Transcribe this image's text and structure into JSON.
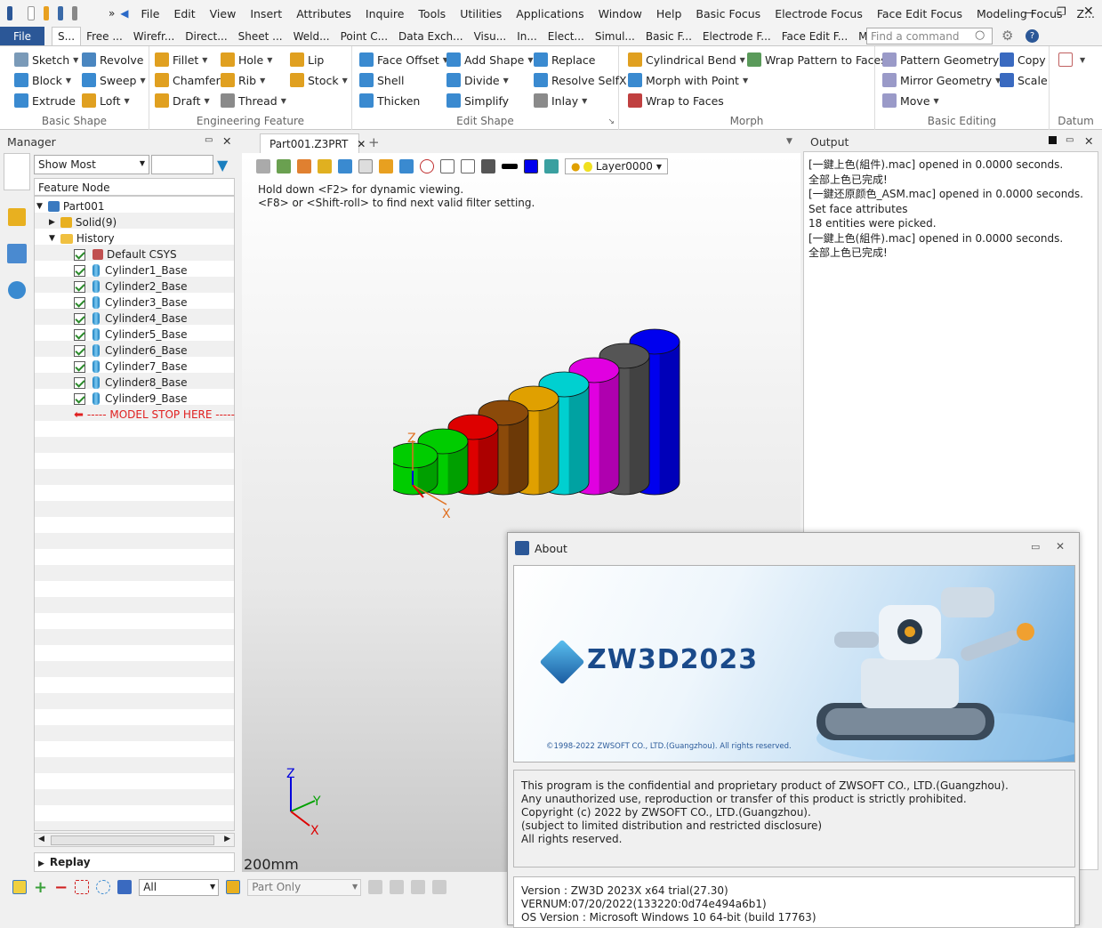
{
  "quick_access": {
    "menu": [
      "File",
      "Edit",
      "View",
      "Insert",
      "Attributes",
      "Inquire",
      "Tools",
      "Utilities",
      "Applications",
      "Window",
      "Help",
      "Basic Focus",
      "Electrode Focus",
      "Face Edit Focus",
      "Modeling Focus",
      "Z..."
    ],
    "overflow": "»"
  },
  "ribbon_tabs": {
    "file": "File",
    "tabs": [
      "S...",
      "Free ...",
      "Wirefr...",
      "Direct...",
      "Sheet ...",
      "Weld...",
      "Point C...",
      "Data Exch...",
      "Visu...",
      "In...",
      "Elect...",
      "Simul...",
      "Basic F...",
      "Electrode F...",
      "Face Edit F...",
      "Modeling F..."
    ],
    "search_placeholder": "Find a command"
  },
  "ribbon": {
    "basic_shape": {
      "label": "Basic Shape",
      "sketch": "Sketch",
      "revolve": "Revolve",
      "block": "Block",
      "sweep": "Sweep",
      "extrude": "Extrude",
      "loft": "Loft"
    },
    "engineering": {
      "label": "Engineering Feature",
      "fillet": "Fillet",
      "hole": "Hole",
      "lip": "Lip",
      "chamfer": "Chamfer",
      "rib": "Rib",
      "stock": "Stock",
      "draft": "Draft",
      "thread": "Thread"
    },
    "edit_shape": {
      "label": "Edit Shape",
      "face_offset": "Face Offset",
      "add_shape": "Add Shape",
      "replace": "Replace",
      "shell": "Shell",
      "divide": "Divide",
      "resolve": "Resolve SelfX",
      "thicken": "Thicken",
      "simplify": "Simplify",
      "inlay": "Inlay"
    },
    "morph": {
      "label": "Morph",
      "cyl_bend": "Cylindrical Bend",
      "wrap_pattern": "Wrap Pattern to Faces",
      "morph_point": "Morph with Point",
      "wrap_faces": "Wrap to Faces"
    },
    "basic_editing": {
      "label": "Basic Editing",
      "pattern": "Pattern Geometry",
      "copy": "Copy",
      "mirror": "Mirror Geometry",
      "scale": "Scale",
      "move": "Move"
    },
    "datum": {
      "label": "Datum"
    }
  },
  "manager": {
    "title": "Manager",
    "filter": "Show Most",
    "tree_header": "Feature Node",
    "root": "Part001",
    "solid": "Solid(9)",
    "history": "History",
    "csys": "Default CSYS",
    "cylinders": [
      "Cylinder1_Base",
      "Cylinder2_Base",
      "Cylinder3_Base",
      "Cylinder4_Base",
      "Cylinder5_Base",
      "Cylinder6_Base",
      "Cylinder7_Base",
      "Cylinder8_Base",
      "Cylinder9_Base"
    ],
    "stop": "----- MODEL STOP HERE -----",
    "replay": "Replay"
  },
  "viewport": {
    "tab": "Part001.Z3PRT",
    "layer": "Layer0000",
    "hint1": "Hold down <F2> for dynamic viewing.",
    "hint2": "<F8> or <Shift-roll> to find next valid filter setting.",
    "scale": "200mm",
    "cylinder_colors": [
      "#00cc00",
      "#00cc00",
      "#dd0000",
      "#8b4a0a",
      "#e0a000",
      "#00d0d0",
      "#e000e0",
      "#555555",
      "#0000ee"
    ]
  },
  "output": {
    "title": "Output",
    "lines": [
      "[一鍵上色(組件).mac] opened in 0.0000 seconds.",
      "全部上色已完成!",
      "[一鍵还原颜色_ASM.mac] opened in 0.0000 seconds.",
      "Set face attributes",
      "18 entities were picked.",
      "[一鍵上色(組件).mac] opened in 0.0000 seconds.",
      "全部上色已完成!"
    ]
  },
  "statusbar": {
    "filter": "All",
    "part": "Part Only"
  },
  "about": {
    "title": "About",
    "logo": "ZW3D2023",
    "copyright_banner": "©1998-2022 ZWSOFT CO., LTD.(Guangzhou).  All rights reserved.",
    "info": [
      "This program is the confidential and proprietary product of ZWSOFT CO., LTD.(Guangzhou).",
      "Any unauthorized use, reproduction or transfer of this product is strictly prohibited.",
      "Copyright (c) 2022 by ZWSOFT CO., LTD.(Guangzhou).",
      "(subject to limited distribution and restricted disclosure)",
      "All rights reserved."
    ],
    "version": "Version : ZW3D 2023X x64 trial(27.30)",
    "vernum": "VERNUM:07/20/2022(133220:0d74e494a6b1)",
    "os": "OS Version : Microsoft Windows 10 64-bit  (build 17763)"
  }
}
